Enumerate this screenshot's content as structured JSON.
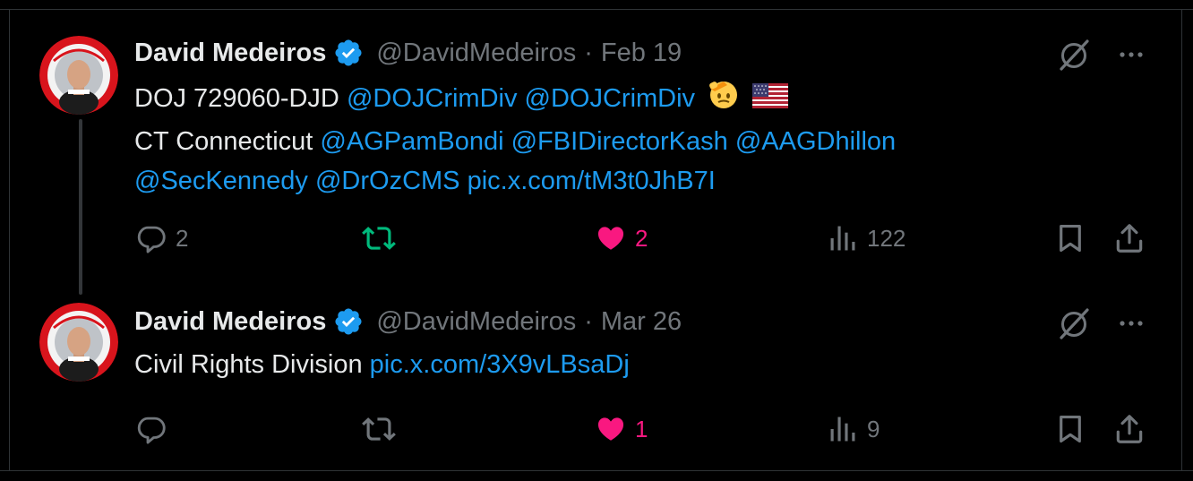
{
  "tweets": [
    {
      "author": {
        "name": "David Medeiros",
        "handle": "@DavidMedeiros",
        "verified": true
      },
      "sep": "·",
      "date": "Feb 19",
      "lines": [
        [
          {
            "t": "text",
            "v": "DOJ 729060-DJD "
          },
          {
            "t": "link",
            "v": "@DOJCrimDiv"
          },
          {
            "t": "text",
            "v": " "
          },
          {
            "t": "link",
            "v": "@DOJCrimDiv"
          }
        ],
        [
          {
            "t": "text",
            "v": "CT Connecticut "
          },
          {
            "t": "link",
            "v": "@AGPamBondi"
          },
          {
            "t": "text",
            "v": " "
          },
          {
            "t": "link",
            "v": "@FBIDirectorKash"
          },
          {
            "t": "text",
            "v": " "
          },
          {
            "t": "link",
            "v": "@AAGDhillon"
          }
        ],
        [
          {
            "t": "link",
            "v": "@SecKennedy"
          },
          {
            "t": "text",
            "v": " "
          },
          {
            "t": "link",
            "v": "@DrOzCMS"
          },
          {
            "t": "text",
            "v": " "
          },
          {
            "t": "link",
            "v": "pic.x.com/tM3t0JhB7I"
          }
        ]
      ],
      "emojis": [
        "saluting-face",
        "us-flag"
      ],
      "stats": {
        "replies": "2",
        "reposts": "",
        "likes": "2",
        "views": "122"
      },
      "state": {
        "reposted": true,
        "liked": true
      }
    },
    {
      "author": {
        "name": "David Medeiros",
        "handle": "@DavidMedeiros",
        "verified": true
      },
      "sep": "·",
      "date": "Mar 26",
      "lines": [
        [
          {
            "t": "text",
            "v": "Civil Rights Division "
          },
          {
            "t": "link",
            "v": "pic.x.com/3X9vLBsaDj"
          }
        ]
      ],
      "emojis": [],
      "stats": {
        "replies": "",
        "reposts": "",
        "likes": "1",
        "views": "9"
      },
      "state": {
        "reposted": false,
        "liked": true
      }
    }
  ],
  "colors": {
    "background": "#000000",
    "text": "#e7e9ea",
    "muted": "#71767b",
    "link": "#1d9bf0",
    "repost_active": "#00ba7c",
    "like_active": "#f91880",
    "border": "#2f3336",
    "verified": "#1d9bf0"
  },
  "icons": [
    "reply-icon",
    "repost-icon",
    "like-icon",
    "views-icon",
    "bookmark-icon",
    "share-icon",
    "grok-icon",
    "more-icon",
    "verified-badge-icon"
  ]
}
